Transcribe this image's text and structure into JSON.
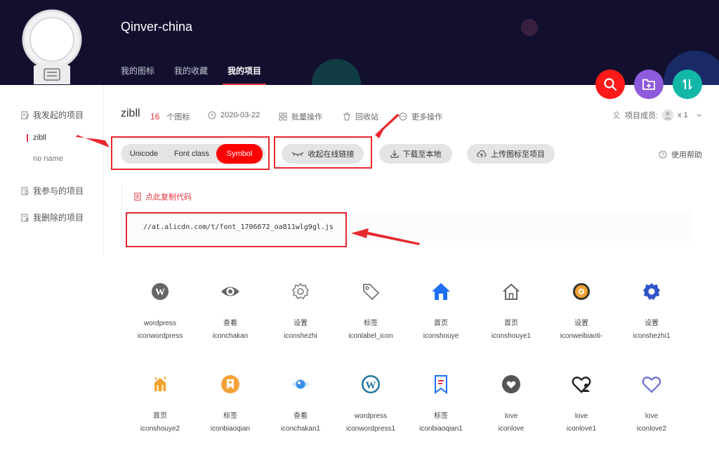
{
  "header": {
    "user_name": "Qinver-china",
    "tabs": [
      "我的图标",
      "我的收藏",
      "我的项目"
    ],
    "active_tab": 2
  },
  "sidebar": {
    "started_label": "我发起的项目",
    "projects": [
      "zibll",
      "no name"
    ],
    "joined_label": "我参与的项目",
    "deleted_label": "我删除的项目"
  },
  "project": {
    "name": "zibll",
    "icon_count": "16",
    "icon_count_unit": "个图标",
    "date": "2020-03-22",
    "batch_label": "批量操作",
    "trash_label": "回收站",
    "more_label": "更多操作",
    "members_label": "项目成员:",
    "members_count": "x 1"
  },
  "modes": [
    "Unicode",
    "Font class",
    "Symbol"
  ],
  "active_mode": "Symbol",
  "actions": {
    "collapse_link": "收起在线链接",
    "download": "下载至本地",
    "upload": "上传图标至项目",
    "help": "使用帮助"
  },
  "code": {
    "copy_label": "点此复制代码",
    "url": "//at.alicdn.com/t/font_1706672_oa811wlg9gl.js"
  },
  "icons": [
    {
      "name": "wordpress",
      "code": "iconwordpress",
      "glyph": "wordpress-icon",
      "color": "#666666"
    },
    {
      "name": "查看",
      "code": "iconchakan",
      "glyph": "eye-icon",
      "color": "#666666"
    },
    {
      "name": "设置",
      "code": "iconshezhi",
      "glyph": "gear-outline-icon",
      "color": "#777777"
    },
    {
      "name": "标签",
      "code": "iconlabel_icon",
      "glyph": "tag-icon",
      "color": "#777777"
    },
    {
      "name": "首页",
      "code": "iconshouye",
      "glyph": "home-filled-icon",
      "color": "#1e6ff5"
    },
    {
      "name": "首页",
      "code": "iconshouye1",
      "glyph": "home-outline-icon",
      "color": "#666666"
    },
    {
      "name": "设置",
      "code": "iconweibiaoti-",
      "glyph": "gear-orange-icon",
      "color": "#f2a12f"
    },
    {
      "name": "设置",
      "code": "iconshezhi1",
      "glyph": "gear-blue-icon",
      "color": "#2f54c8"
    },
    {
      "name": "首页",
      "code": "iconshouye2",
      "glyph": "home-color-icon",
      "color": "#f2a12f"
    },
    {
      "name": "标签",
      "code": "iconbiaoqian",
      "glyph": "tag-round-icon",
      "color": "#f6a23a"
    },
    {
      "name": "查看",
      "code": "iconchakan1",
      "glyph": "eye-blue-icon",
      "color": "#3a8ee6"
    },
    {
      "name": "wordpress",
      "code": "iconwordpress1",
      "glyph": "wordpress-blue-icon",
      "color": "#21759b"
    },
    {
      "name": "标签",
      "code": "iconbiaoqian1",
      "glyph": "bookmark-icon",
      "color": "#1e6ff5"
    },
    {
      "name": "love",
      "code": "iconlove",
      "glyph": "heart-circle-icon",
      "color": "#555555"
    },
    {
      "name": "love",
      "code": "iconlove1",
      "glyph": "heart-person-icon",
      "color": "#222222"
    },
    {
      "name": "love",
      "code": "iconlove2",
      "glyph": "heart-outline-icon",
      "color": "#6b6fd6"
    }
  ],
  "colors": {
    "header_bg": "#12102e",
    "accent_red": "#e5343e",
    "search_fab": "#ff1a1a",
    "add_fab": "#8e5bdc",
    "sort_fab": "#13b7a8"
  }
}
